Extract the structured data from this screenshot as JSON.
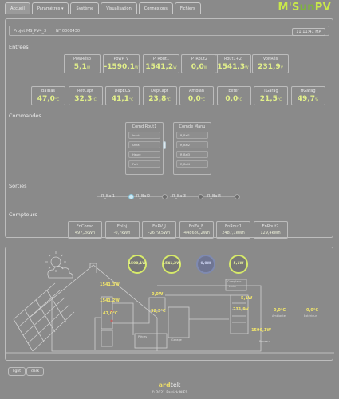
{
  "nav": {
    "tabs": [
      "Accueil",
      "Paramètres ▾",
      "Système",
      "Visualisation",
      "Connexions",
      "Fichiers"
    ],
    "active_tab": "Accueil"
  },
  "logo": {
    "main": "M'S",
    "small": "un",
    "end": "PV"
  },
  "project": {
    "name": "Projet MS_PV4_3",
    "serial": "N° 0000430",
    "clock": "11:11:41 MA"
  },
  "sections": {
    "entrees": "Entrées",
    "commandes": "Commandes",
    "sorties": "Sorties",
    "compteurs": "Compteurs"
  },
  "entrees_row1": [
    {
      "label": "PowRéso",
      "value": "5,1",
      "unit": "W"
    },
    {
      "label": "PowP_V",
      "value": "-1590,1",
      "unit": "W"
    },
    {
      "label": "P_Rout1",
      "value": "1541,2",
      "unit": "W"
    },
    {
      "label": "P_Rout2",
      "value": "0,0",
      "unit": "W"
    },
    {
      "label": "Rout1+2",
      "value": "1541,3",
      "unit": "W"
    },
    {
      "label": "VoltRés",
      "value": "231,9",
      "unit": "V"
    }
  ],
  "entrees_row2": [
    {
      "label": "BalBas",
      "value": "47,0",
      "unit": "°C"
    },
    {
      "label": "RetCapt",
      "value": "32,3",
      "unit": "°C"
    },
    {
      "label": "DepECS",
      "value": "41,1",
      "unit": "°C"
    },
    {
      "label": "DepCapt",
      "value": "23,8",
      "unit": "°C"
    },
    {
      "label": "Ambian",
      "value": "0,0",
      "unit": "°C"
    },
    {
      "label": "Exter",
      "value": "0,0",
      "unit": "°C"
    },
    {
      "label": "TGarag",
      "value": "21,5",
      "unit": "°C"
    },
    {
      "label": "HGarag",
      "value": "49,7",
      "unit": "%"
    }
  ],
  "commandes": {
    "col1_title": "Comd Rout1",
    "col1_items": [
      "Inact",
      "Ultra",
      "Heure",
      "Fort"
    ],
    "col2_title": "Comde Manu",
    "col2_items": [
      "R_Bal1",
      "R_Bal2",
      "R_Bal3",
      "R_Bal4"
    ]
  },
  "sorties": [
    {
      "label": "R_Bal1",
      "on": true
    },
    {
      "label": "R_Bal2",
      "on": false
    },
    {
      "label": "R_Bal3",
      "on": false
    },
    {
      "label": "R_Bal4",
      "on": false
    }
  ],
  "compteurs": [
    {
      "label": "EnConso",
      "value": "497,2kWh"
    },
    {
      "label": "EnInj",
      "value": "-0,7kWh"
    },
    {
      "label": "EnPV_J",
      "value": "-2679,5Wh"
    },
    {
      "label": "EnPV_F",
      "value": "-448680,2Wh"
    },
    {
      "label": "EnRout1",
      "value": "2487,1kWh"
    },
    {
      "label": "EnRout2",
      "value": "129,4kWh"
    }
  ],
  "diagram": {
    "gauges": [
      "1590,1W",
      "1541,2W",
      "0,0W",
      "5,1W"
    ],
    "labels": {
      "pv_top": "1541,3W",
      "pv_mid": "1541,2W",
      "rout2": "0,0W",
      "temp1": "47,0°C",
      "temp2": "32,3°C",
      "voltage": "231,9V",
      "reseau": "5,1W",
      "pv_total": "-1590,1W",
      "temp3": "0,0°C",
      "temp4": "0,0°C"
    },
    "small": {
      "compteur": "Compteur",
      "linky": "Linky",
      "ambiante": "Ambiante",
      "exterieur": "Extérieur",
      "reseau_ch": "Réseau",
      "pieces": "Pièces",
      "garage": "Garage"
    }
  },
  "theme": {
    "light": "light",
    "dark": "dark"
  },
  "footer": {
    "brand_a": "ard",
    "brand_b": "tek",
    "copyright": "© 2021 Patrick NIES"
  },
  "colors": {
    "accent": "#e2f08a",
    "logo": "#c9e84a",
    "background": "#8a8a8a"
  }
}
